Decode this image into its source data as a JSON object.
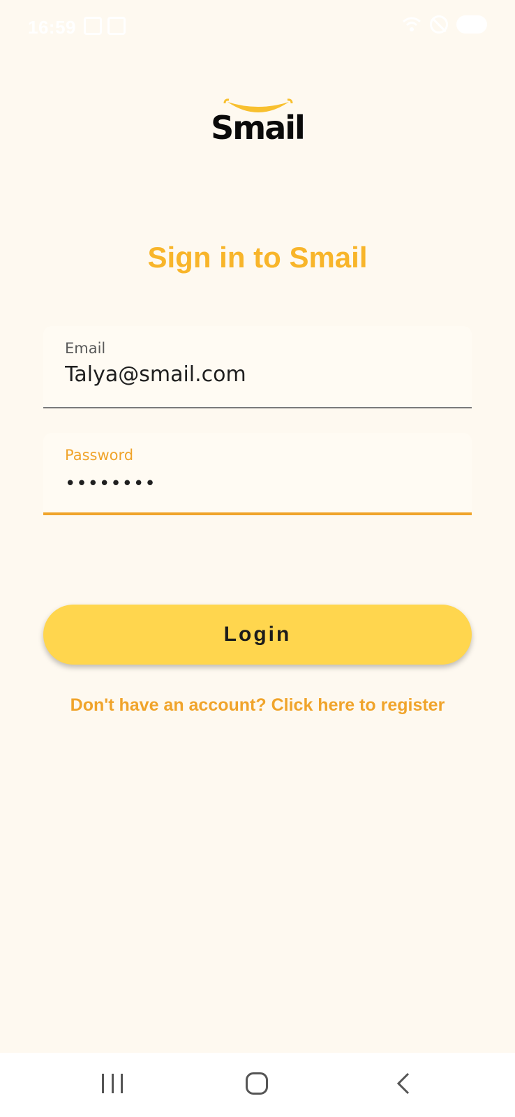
{
  "status_bar": {
    "time": "16:59"
  },
  "logo": {
    "text": "Smail",
    "smile_color": "#F8C02F"
  },
  "title": "Sign in to Smail",
  "form": {
    "email": {
      "label": "Email",
      "value": "Talya@smail.com"
    },
    "password": {
      "label": "Password",
      "masked_value": "••••••••"
    }
  },
  "login_button": {
    "label": "Login"
  },
  "register_link": {
    "label": "Don't have an account? Click here to register"
  },
  "colors": {
    "background": "#FEF9F0",
    "accent": "#F8B52A",
    "button": "#FFD64E",
    "focus_underline": "#F0A42B"
  },
  "nav_bar": {
    "recents": "recents-icon",
    "home": "home-icon",
    "back": "back-icon"
  }
}
